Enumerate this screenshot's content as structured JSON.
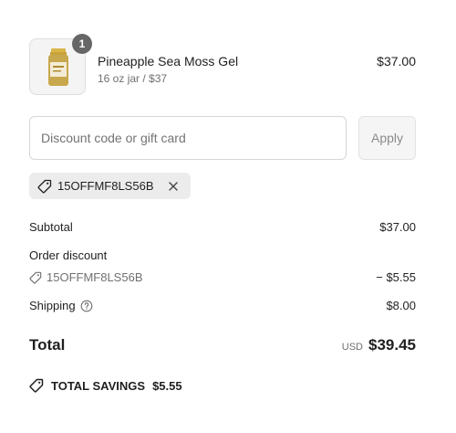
{
  "product": {
    "name": "Pineapple Sea Moss Gel",
    "variant": "16 oz jar / $37",
    "price": "$37.00",
    "quantity": "1",
    "image_icon": "jar-product-image"
  },
  "discount": {
    "placeholder": "Discount code or gift card",
    "value": "",
    "apply_label": "Apply",
    "applied_code": "15OFFMF8LS56B"
  },
  "summary": {
    "subtotal_label": "Subtotal",
    "subtotal_value": "$37.00",
    "order_discount_label": "Order discount",
    "discount_code": "15OFFMF8LS56B",
    "discount_value": "− $5.55",
    "shipping_label": "Shipping",
    "shipping_value": "$8.00",
    "total_label": "Total",
    "currency": "USD",
    "total_value": "$39.45",
    "savings_label": "TOTAL SAVINGS",
    "savings_value": "$5.55"
  },
  "colors": {
    "text": "#1f1f1f",
    "muted": "#707070",
    "chip_bg": "#ececec",
    "badge_bg": "#666666"
  }
}
